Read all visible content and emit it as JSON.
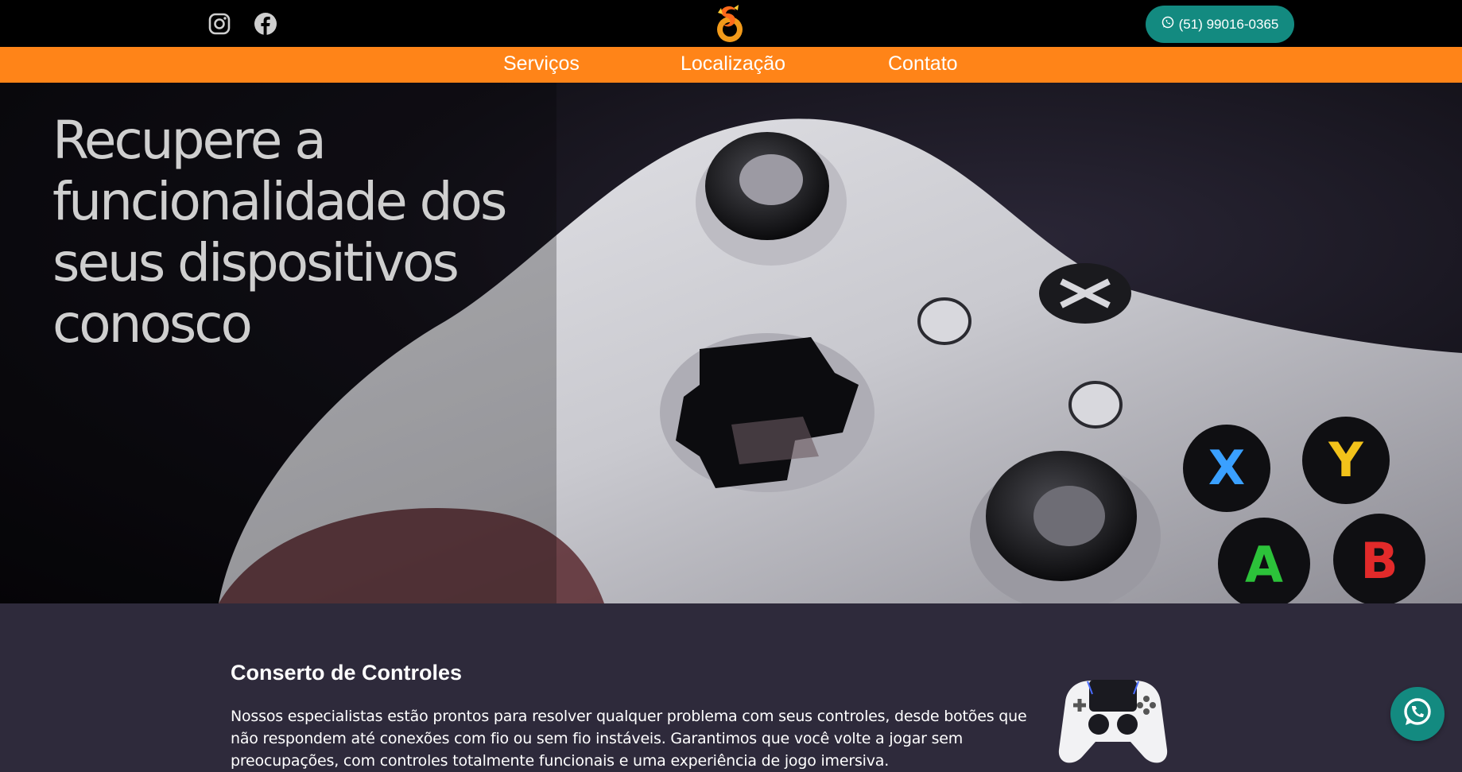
{
  "header": {
    "social": [
      {
        "name": "instagram-icon"
      },
      {
        "name": "facebook-icon"
      }
    ],
    "whatsapp_button": {
      "label": "(51) 99016-0365",
      "icon": "whatsapp-icon",
      "color": "#138a80"
    }
  },
  "nav": {
    "color": "#ff8418",
    "items": [
      {
        "label": "Serviços"
      },
      {
        "label": "Localização"
      },
      {
        "label": "Contato"
      }
    ]
  },
  "hero": {
    "title": "Recupere a funcionalidade dos seus dispositivos conosco",
    "image": "xbox-controller-photo"
  },
  "services": {
    "title": "Conserto de Controles",
    "text": "Nossos especialistas estão prontos para resolver qualquer problema com seus controles, desde botões que não respondem até conexões com fio ou sem fio instáveis. Garantimos que você volte a jogar sem preocupações, com controles totalmente funcionais e uma experiência de jogo imersiva.",
    "image": "playstation-controller-image"
  },
  "floating": {
    "icon": "whatsapp-icon"
  }
}
